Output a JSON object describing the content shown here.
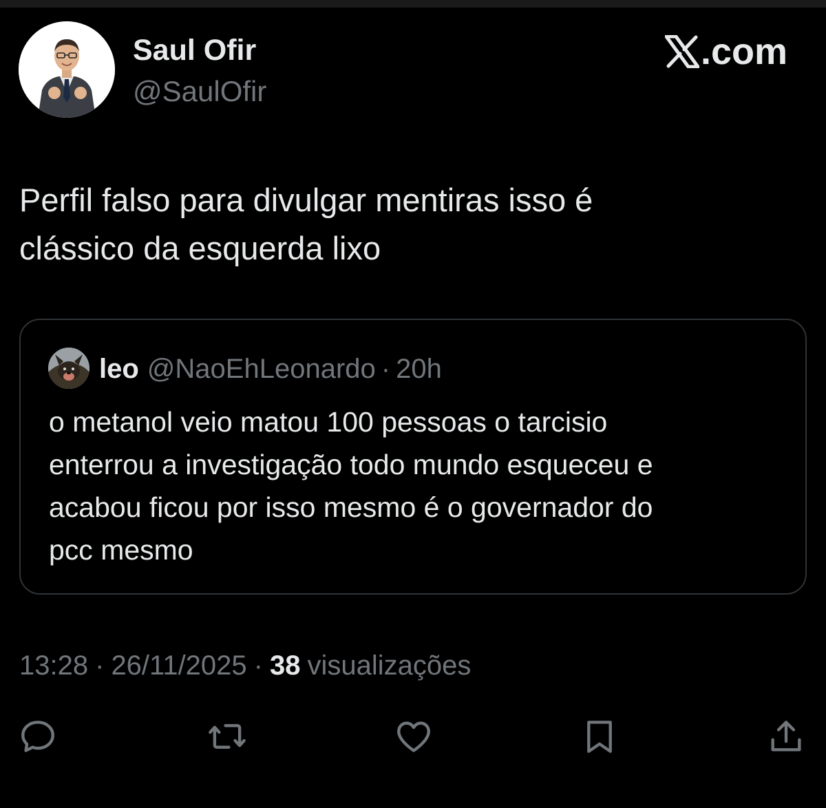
{
  "colors": {
    "background": "#000000",
    "text_primary": "#e7e9ea",
    "text_secondary": "#71767b",
    "border": "#2f3336"
  },
  "tweet": {
    "author": {
      "display_name": "Saul Ofir",
      "handle": "@SaulOfir",
      "avatar_icon": "cartoon-businessman-avatar"
    },
    "brand": {
      "label": ".com",
      "icon": "x-logo-icon"
    },
    "text_line1": "Perfil falso para divulgar mentiras isso é",
    "text_line2": "clássico da esquerda lixo",
    "quote": {
      "display_name": "leo",
      "handle": "@NaoEhLeonardo",
      "separator": "·",
      "time": "20h",
      "avatar_icon": "dog-avatar",
      "text_line1": "o metanol veio matou 100 pessoas o tarcisio",
      "text_line2": "enterrou a investigação todo mundo esqueceu e",
      "text_line3": "acabou ficou por isso mesmo é o governador do",
      "text_line4": "pcc mesmo"
    },
    "meta": {
      "time": "13:28",
      "separator": "·",
      "date": "26/11/2025",
      "views_count": "38",
      "views_label": "visualizações"
    },
    "actions": [
      {
        "name": "reply",
        "icon": "reply-icon"
      },
      {
        "name": "repost",
        "icon": "repost-icon"
      },
      {
        "name": "like",
        "icon": "heart-icon"
      },
      {
        "name": "bookmark",
        "icon": "bookmark-icon"
      },
      {
        "name": "share",
        "icon": "share-icon"
      }
    ]
  }
}
